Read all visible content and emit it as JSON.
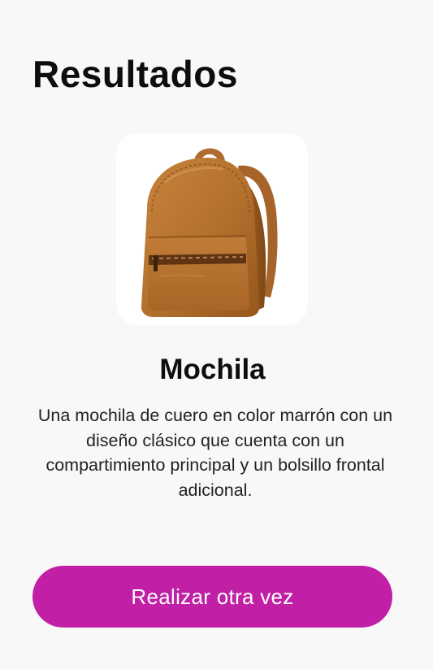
{
  "header": {
    "title": "Resultados"
  },
  "result": {
    "image_icon": "backpack-image",
    "name": "Mochila",
    "description": "Una mochila de cuero en color marrón con un diseño clásico que cuenta con un compartimiento principal y un bolsillo frontal adicional."
  },
  "actions": {
    "retry_label": "Realizar otra vez"
  },
  "colors": {
    "background": "#f8f8f8",
    "button": "#c11fa6",
    "leather": "#b5722f"
  }
}
